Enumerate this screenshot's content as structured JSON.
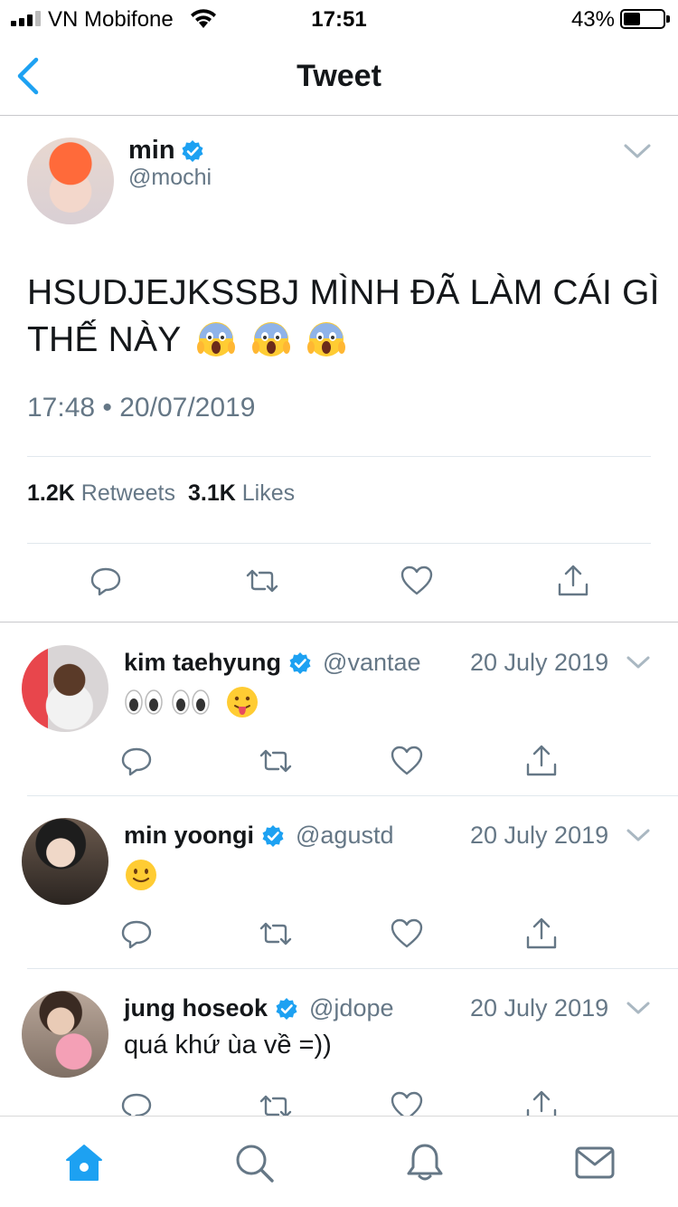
{
  "status_bar": {
    "carrier": "VN Mobifone",
    "time": "17:51",
    "battery_pct": "43%"
  },
  "nav": {
    "title": "Tweet"
  },
  "main_tweet": {
    "name": "min",
    "handle": "@mochi",
    "text": "HSUDJEJKSSBJ MÌNH ĐÃ LÀM CÁI GÌ THẾ NÀY",
    "emoji": [
      "scream-emoji",
      "scream-emoji",
      "scream-emoji"
    ],
    "timestamp": "17:48 • 20/07/2019",
    "retweets_count": "1.2K",
    "retweets_label": "Retweets",
    "likes_count": "3.1K",
    "likes_label": "Likes"
  },
  "replies": [
    {
      "name": "kim taehyung",
      "handle": "@vantae",
      "date": "20 July 2019",
      "emoji": [
        "eyes-emoji",
        "eyes-emoji",
        "tongue-face-emoji"
      ]
    },
    {
      "name": "min yoongi",
      "handle": "@agustd",
      "date": "20 July 2019",
      "emoji": [
        "slight-smile-emoji"
      ]
    },
    {
      "name": "jung hoseok",
      "handle": "@jdope",
      "date": "20 July 2019",
      "text": "quá khứ ùa về =))"
    }
  ],
  "colors": {
    "accent": "#1da1f2",
    "secondary_text": "#657786",
    "primary_text": "#14171a",
    "icon_gray": "#657786"
  },
  "tab_bar": [
    "home-icon",
    "search-icon",
    "notifications-icon",
    "messages-icon"
  ]
}
